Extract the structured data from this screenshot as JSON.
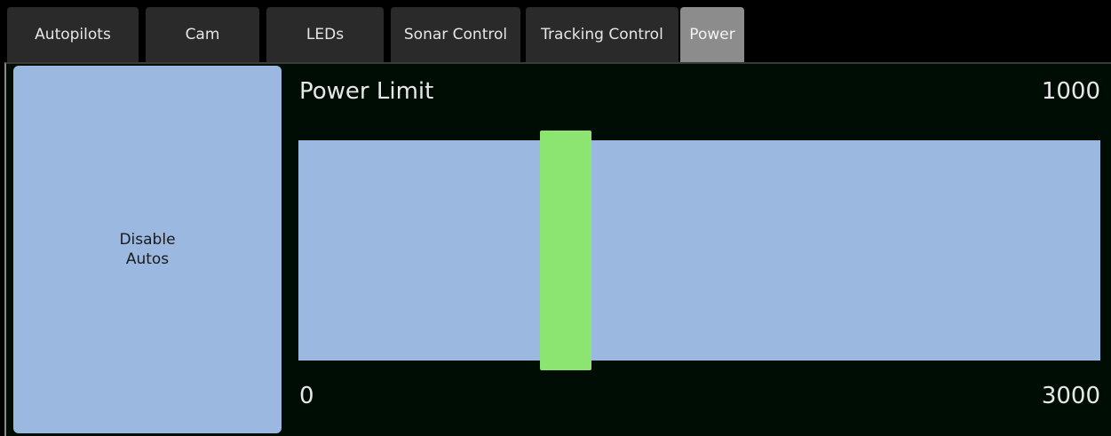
{
  "tabs": [
    {
      "label": "Autopilots",
      "active": false
    },
    {
      "label": "Cam",
      "active": false
    },
    {
      "label": "LEDs",
      "active": false
    },
    {
      "label": "Sonar Control",
      "active": false
    },
    {
      "label": "Tracking Control",
      "active": false
    },
    {
      "label": "Power",
      "active": true
    }
  ],
  "disable_button": {
    "label": "Disable\nAutos"
  },
  "power_limit": {
    "title": "Power Limit",
    "value_label": "1000",
    "min_label": "0",
    "max_label": "3000",
    "min": 0,
    "max": 3000,
    "value": 1000
  },
  "colors": {
    "track": "#9bb9e0",
    "handle": "#8de571",
    "active_tab": "#8c8c8c",
    "tab": "#2a2a2a"
  }
}
